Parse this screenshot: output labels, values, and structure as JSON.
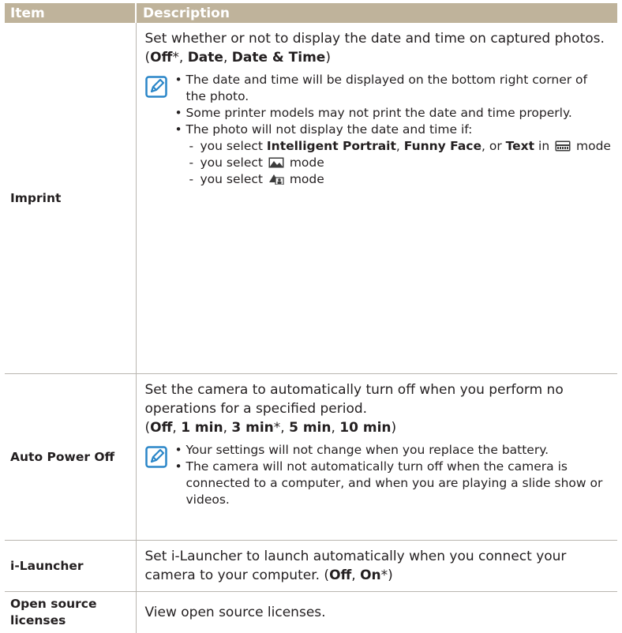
{
  "header": {
    "item": "Item",
    "description": "Description"
  },
  "rows": {
    "imprint": {
      "item": "Imprint",
      "desc_text": "Set whether or not to display the date and time on captured photos. (",
      "opt1": "Off",
      "opt1_suffix": "*, ",
      "opt2": "Date",
      "opt2_suffix": ", ",
      "opt3": "Date & Time",
      "close": ")",
      "notes": [
        "The date and time will be displayed on the bottom right corner of the photo.",
        "Some printer models may not print the date and time properly.",
        "The photo will not display the date and time if:"
      ],
      "sub1": {
        "pre": "you select ",
        "b1": "Intelligent Portrait",
        "m1": ", ",
        "b2": "Funny Face",
        "m2": ", or ",
        "b3": "Text",
        "m3": " in ",
        "post": " mode"
      },
      "sub2": {
        "pre": "you select ",
        "post": " mode"
      },
      "sub3": {
        "pre": "you select ",
        "post": " mode"
      }
    },
    "auto_power_off": {
      "item": "Auto Power Off",
      "desc_text": "Set the camera to automatically turn off when you perform no operations for a specified period.",
      "open": "(",
      "o1": "Off",
      "s1": ", ",
      "o2": "1 min",
      "s2": ", ",
      "o3": "3 min",
      "s3": "*, ",
      "o4": "5 min",
      "s4": ", ",
      "o5": "10 min",
      "close": ")",
      "notes": [
        "Your settings will not change when you replace the battery.",
        "The camera will not automatically turn off when the camera is connected to a computer, and when you are playing a slide show or videos."
      ]
    },
    "i_launcher": {
      "item": "i-Launcher",
      "desc_text": "Set i-Launcher to launch automatically when you connect your camera to your computer. (",
      "o1": "Off",
      "s1": ", ",
      "o2": "On",
      "close": "*)"
    },
    "open_source": {
      "item": "Open source licenses",
      "desc_text": "View open source licenses."
    }
  },
  "icons": {
    "note": "note-pencil-icon",
    "scene": "scene-mode-icon",
    "panorama": "panorama-mode-icon",
    "magic": "magic-frame-mode-icon"
  },
  "colors": {
    "header_bg": "#bfb39b",
    "note_icon": "#2a86c8"
  }
}
